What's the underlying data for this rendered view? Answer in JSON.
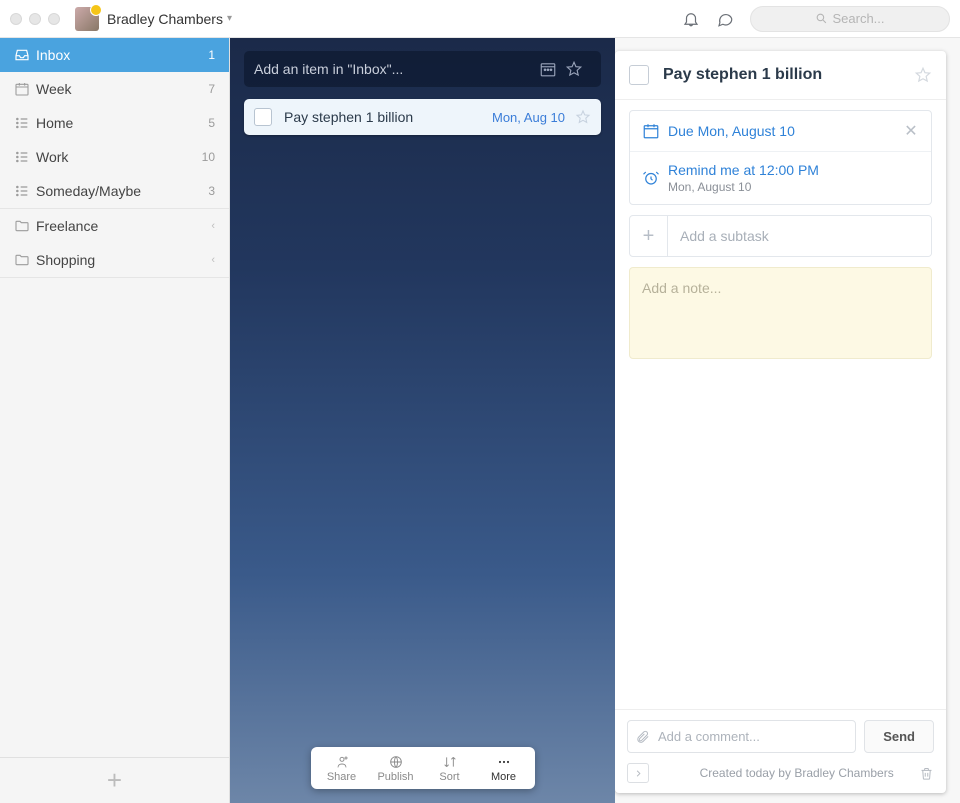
{
  "titlebar": {
    "user_name": "Bradley Chambers",
    "search_placeholder": "Search..."
  },
  "sidebar": {
    "items": [
      {
        "icon": "inbox",
        "label": "Inbox",
        "count": "1",
        "active": true
      },
      {
        "icon": "week",
        "label": "Week",
        "count": "7"
      },
      {
        "icon": "list",
        "label": "Home",
        "count": "5"
      },
      {
        "icon": "list",
        "label": "Work",
        "count": "10"
      },
      {
        "icon": "list",
        "label": "Someday/Maybe",
        "count": "3"
      },
      {
        "icon": "folder",
        "label": "Freelance",
        "chevron": true
      },
      {
        "icon": "folder",
        "label": "Shopping",
        "chevron": true
      }
    ]
  },
  "center": {
    "add_placeholder": "Add an item in \"Inbox\"...",
    "task": {
      "title": "Pay stephen 1 billion",
      "date": "Mon, Aug 10"
    },
    "tools": [
      {
        "label": "Share"
      },
      {
        "label": "Publish"
      },
      {
        "label": "Sort"
      },
      {
        "label": "More",
        "dark": true
      }
    ]
  },
  "detail": {
    "title": "Pay stephen 1 billion",
    "due_label": "Due Mon, August 10",
    "reminder_label": "Remind me at 12:00 PM",
    "reminder_sub": "Mon, August 10",
    "subtask_placeholder": "Add a subtask",
    "note_placeholder": "Add a note...",
    "comment_placeholder": "Add a comment...",
    "send_label": "Send",
    "created_text": "Created today by Bradley Chambers"
  }
}
